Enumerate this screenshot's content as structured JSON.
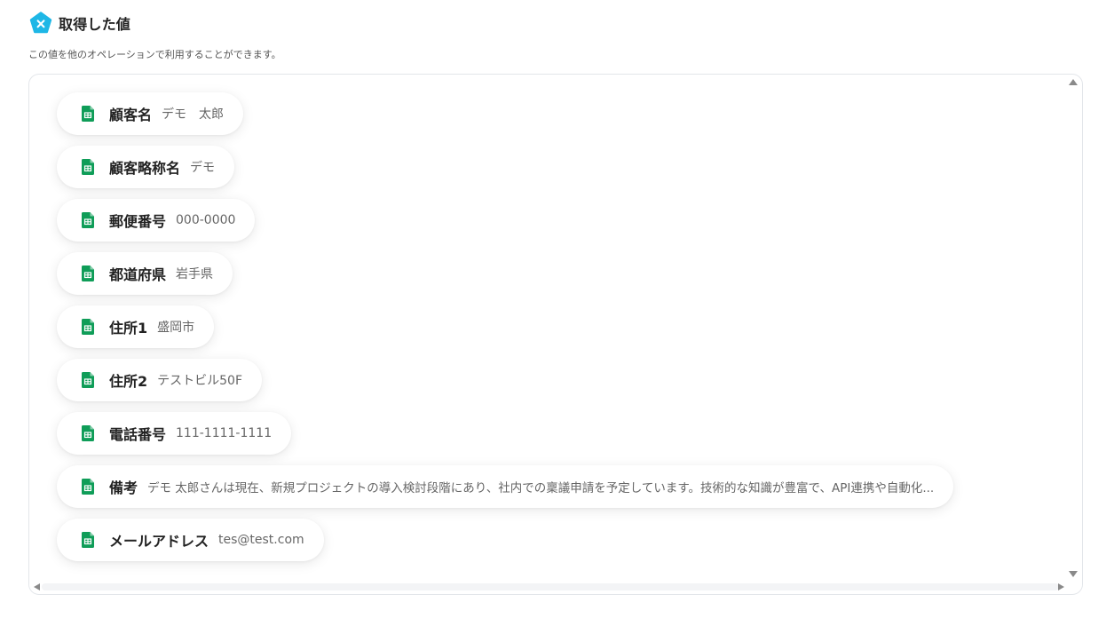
{
  "header": {
    "title": "取得した値",
    "icon": "variable-icon",
    "icon_color": "#1eb7e6"
  },
  "description": "この値を他のオペレーションで利用することができます。",
  "fields": [
    {
      "key": "顧客名",
      "value": "デモ　太郎"
    },
    {
      "key": "顧客略称名",
      "value": "デモ"
    },
    {
      "key": "郵便番号",
      "value": "000-0000"
    },
    {
      "key": "都道府県",
      "value": "岩手県"
    },
    {
      "key": "住所1",
      "value": "盛岡市"
    },
    {
      "key": "住所2",
      "value": "テストビル50F"
    },
    {
      "key": "電話番号",
      "value": "111-1111-1111"
    },
    {
      "key": "備考",
      "value": "デモ 太郎さんは現在、新規プロジェクトの導入検討段階にあり、社内での稟議申請を予定しています。技術的な知識が豊富で、API連携や自動化..."
    },
    {
      "key": "メールアドレス",
      "value": "tes@test.com"
    }
  ],
  "field_icon": "google-sheets-icon",
  "colors": {
    "sheets_green": "#0f9d58",
    "panel_border": "#e3e6ea"
  }
}
